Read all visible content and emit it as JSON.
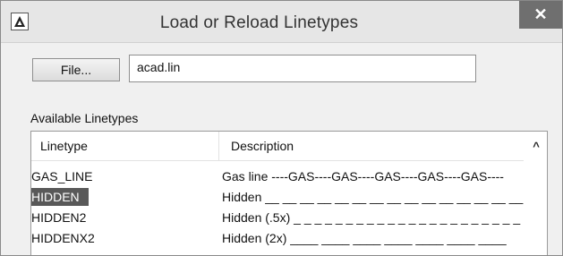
{
  "window": {
    "title": "Load or Reload Linetypes",
    "close_symbol": "✕",
    "app_icon": "autocad-logo-icon"
  },
  "file_row": {
    "button_label": "File...",
    "filename_value": "acad.lin"
  },
  "available_label": "Available Linetypes",
  "table": {
    "columns": [
      "Linetype",
      "Description"
    ],
    "scroll_up_symbol": "^",
    "rows": [
      {
        "name": "GAS_LINE",
        "description": "Gas line ----GAS----GAS----GAS----GAS----GAS----",
        "selected": false
      },
      {
        "name": "HIDDEN",
        "description": "Hidden __ __ __ __ __ __ __ __ __ __ __ __ __ __ __ .",
        "selected": true
      },
      {
        "name": "HIDDEN2",
        "description": "Hidden (.5x) _ _ _ _ _ _ _ _ _ _ _ _ _ _ _ _ _ _ _ _ _ _",
        "selected": false
      },
      {
        "name": "HIDDENX2",
        "description": "Hidden (2x) ____ ____ ____ ____ ____ ____ ____",
        "selected": false
      }
    ]
  },
  "colors": {
    "selection": "#595959",
    "close_button": "#6f6f6f"
  }
}
